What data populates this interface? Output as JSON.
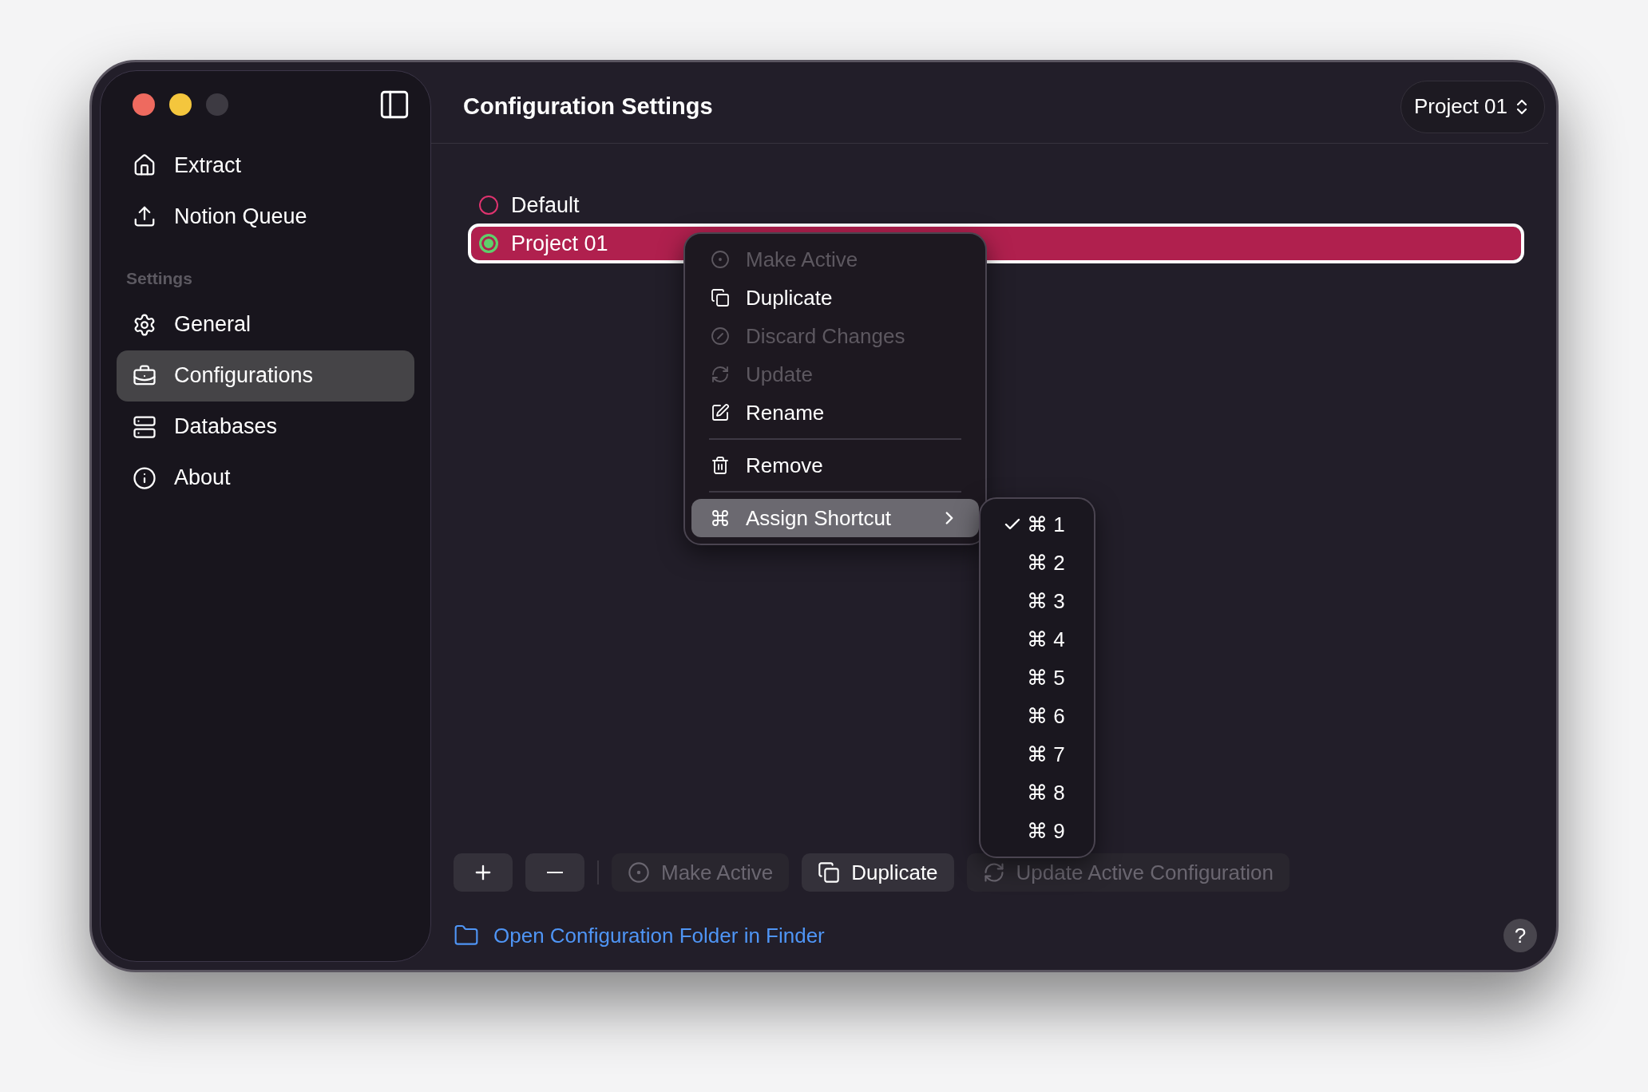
{
  "sidebar": {
    "items": [
      {
        "label": "Extract",
        "selected": false
      },
      {
        "label": "Notion Queue",
        "selected": false
      }
    ],
    "section": {
      "title": "Settings",
      "items": [
        {
          "label": "General",
          "selected": false
        },
        {
          "label": "Configurations",
          "selected": true
        },
        {
          "label": "Databases",
          "selected": false
        },
        {
          "label": "About",
          "selected": false
        }
      ]
    }
  },
  "header": {
    "title": "Configuration Settings",
    "picker": {
      "value": "Project 01"
    }
  },
  "configurations": [
    {
      "name": "Default",
      "active": false,
      "selected": false
    },
    {
      "name": "Project 01",
      "active": true,
      "selected": true
    }
  ],
  "context_menu": {
    "items": [
      {
        "kind": "item",
        "label": "Make Active",
        "disabled": true,
        "selected": false
      },
      {
        "kind": "item",
        "label": "Duplicate",
        "disabled": false,
        "selected": false
      },
      {
        "kind": "item",
        "label": "Discard Changes",
        "disabled": true,
        "selected": false
      },
      {
        "kind": "item",
        "label": "Update",
        "disabled": true,
        "selected": false
      },
      {
        "kind": "item",
        "label": "Rename",
        "disabled": false,
        "selected": false
      },
      {
        "kind": "separator"
      },
      {
        "kind": "item",
        "label": "Remove",
        "disabled": false,
        "selected": false
      },
      {
        "kind": "separator"
      },
      {
        "kind": "submenu",
        "label": "Assign Shortcut",
        "disabled": false,
        "selected": true
      }
    ]
  },
  "shortcut_menu": {
    "items": [
      {
        "label": "⌘ 1",
        "checked": true
      },
      {
        "label": "⌘ 2",
        "checked": false
      },
      {
        "label": "⌘ 3",
        "checked": false
      },
      {
        "label": "⌘ 4",
        "checked": false
      },
      {
        "label": "⌘ 5",
        "checked": false
      },
      {
        "label": "⌘ 6",
        "checked": false
      },
      {
        "label": "⌘ 7",
        "checked": false
      },
      {
        "label": "⌘ 8",
        "checked": false
      },
      {
        "label": "⌘ 9",
        "checked": false
      }
    ]
  },
  "toolbar": [
    {
      "kind": "add",
      "disabled": false
    },
    {
      "kind": "remove",
      "disabled": false
    },
    {
      "kind": "divider"
    },
    {
      "kind": "text",
      "label": "Make Active",
      "disabled": true
    },
    {
      "kind": "text",
      "label": "Duplicate",
      "disabled": false
    },
    {
      "kind": "text",
      "label": "Update Active Configuration",
      "disabled": true
    }
  ],
  "footer": {
    "link": "Open Configuration Folder in Finder",
    "help": "?"
  }
}
